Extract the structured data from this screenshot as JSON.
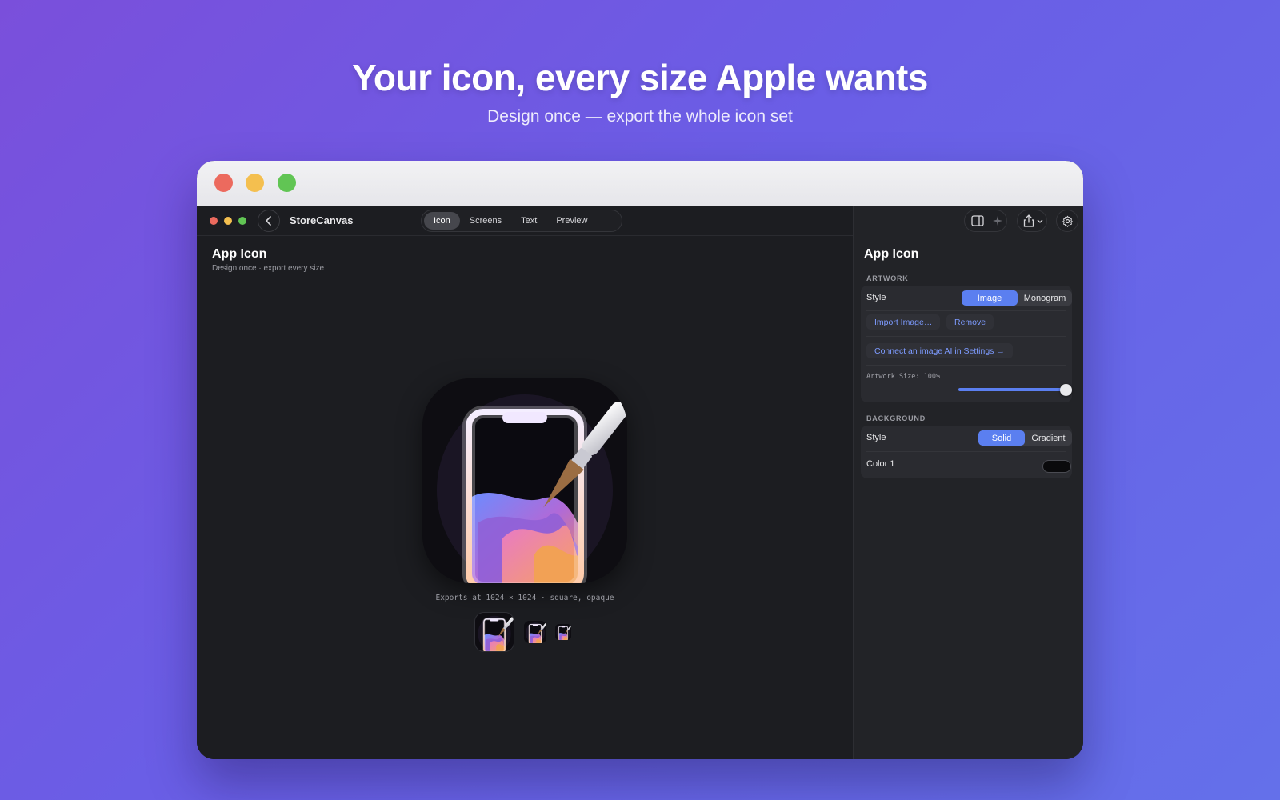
{
  "hero": {
    "title": "Your icon, every size Apple wants",
    "subtitle": "Design once — export the whole icon set"
  },
  "app": {
    "name": "StoreCanvas",
    "tabs": [
      {
        "label": "Icon",
        "active": true
      },
      {
        "label": "Screens",
        "active": false
      },
      {
        "label": "Text",
        "active": false
      },
      {
        "label": "Preview",
        "active": false
      }
    ]
  },
  "canvas": {
    "title": "App Icon",
    "subtitle": "Design once · export every size",
    "export_caption": "Exports at 1024 × 1024 · square, opaque"
  },
  "inspector": {
    "title": "App Icon",
    "artwork": {
      "section": "ARTWORK",
      "style_label": "Style",
      "style_options": [
        "Image",
        "Monogram"
      ],
      "style_selected": "Image",
      "import_label": "Import Image…",
      "remove_label": "Remove",
      "connect_label": "Connect an image AI in Settings →",
      "size_label": "Artwork Size: 100%",
      "size_value": 1.0
    },
    "background": {
      "section": "BACKGROUND",
      "style_label": "Style",
      "style_options": [
        "Solid",
        "Gradient"
      ],
      "style_selected": "Solid",
      "color_label": "Color 1",
      "color_value": "#0a0a0c"
    }
  },
  "colors": {
    "accent": "#5b7ff0",
    "link": "#7d9bff",
    "traffic_red": "#ec6a5e",
    "traffic_yellow": "#f4bf4f",
    "traffic_green": "#61c554"
  }
}
